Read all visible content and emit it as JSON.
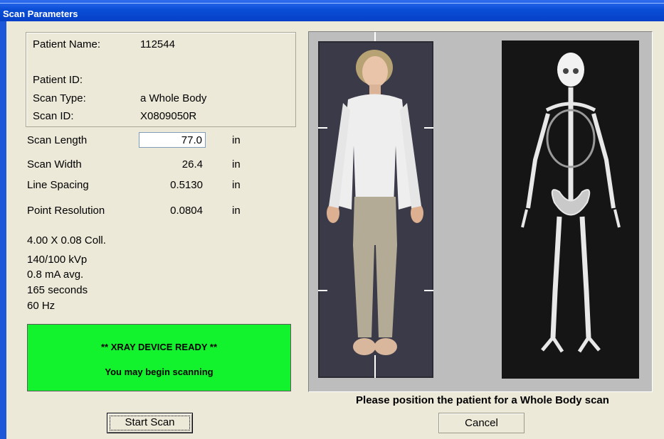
{
  "window": {
    "title": "Scan Parameters"
  },
  "patient": {
    "name_label": "Patient Name:",
    "name_value": "112544",
    "id_label": "Patient ID:",
    "id_value": "",
    "scan_type_label": "Scan Type:",
    "scan_type_value": "a Whole Body",
    "scan_id_label": "Scan ID:",
    "scan_id_value": "X0809050R"
  },
  "params": {
    "scan_length": {
      "label": "Scan Length",
      "value": "77.0",
      "unit": "in"
    },
    "scan_width": {
      "label": "Scan Width",
      "value": "26.4",
      "unit": "in"
    },
    "line_spacing": {
      "label": "Line Spacing",
      "value": "0.5130",
      "unit": "in"
    },
    "point_resolution": {
      "label": "Point Resolution",
      "value": "0.0804",
      "unit": "in"
    }
  },
  "technique": {
    "collimation": "4.00 X 0.08 Coll.",
    "kvp": "140/100 kVp",
    "ma": "0.8 mA avg.",
    "duration": "165 seconds",
    "frequency": "60 Hz"
  },
  "status": {
    "line1": "** XRAY DEVICE READY **",
    "line2": "You may begin scanning",
    "color": "#13f32d"
  },
  "buttons": {
    "start": "Start Scan",
    "cancel": "Cancel"
  },
  "preview": {
    "caption": "Please position the patient for a Whole Body scan",
    "photo_icon": "patient-photo",
    "xray_icon": "xray-skeleton"
  }
}
